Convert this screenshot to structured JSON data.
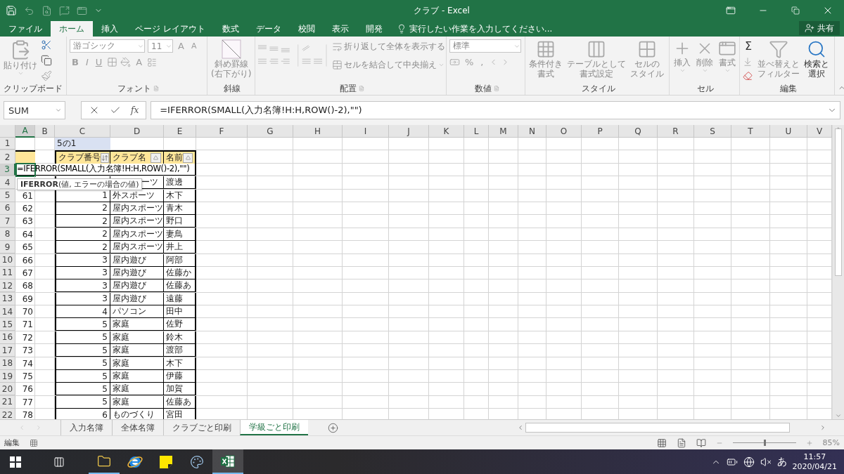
{
  "title_bar": {
    "title": "クラブ - Excel"
  },
  "ribbon_tabs": [
    {
      "label": "ファイル",
      "selected": false
    },
    {
      "label": "ホーム",
      "selected": true
    },
    {
      "label": "挿入",
      "selected": false
    },
    {
      "label": "ページ レイアウト",
      "selected": false
    },
    {
      "label": "数式",
      "selected": false
    },
    {
      "label": "データ",
      "selected": false
    },
    {
      "label": "校閲",
      "selected": false
    },
    {
      "label": "表示",
      "selected": false
    },
    {
      "label": "開発",
      "selected": false
    }
  ],
  "tell_me": "実行したい作業を入力してください...",
  "share": "共有",
  "ribbon": {
    "clipboard": {
      "label": "クリップボード",
      "paste": "貼り付け"
    },
    "font": {
      "label": "フォント",
      "font_name": "游ゴシック",
      "font_size": "11",
      "grow": "A",
      "shrink": "A",
      "styles": [
        "B",
        "I",
        "U"
      ],
      "font_color": "A"
    },
    "diagonal": {
      "label": "斜線",
      "button": [
        "斜め罫線",
        "(右下がり)"
      ]
    },
    "alignment": {
      "label": "配置",
      "wrap": "折り返して全体を表示する",
      "merge": "セルを結合して中央揃え"
    },
    "number": {
      "label": "数値",
      "format": "標準",
      "percent": "%",
      "comma": ","
    },
    "styles": {
      "label": "スタイル",
      "buttons": [
        [
          "条件付き",
          "書式"
        ],
        [
          "テーブルとして",
          "書式設定"
        ],
        [
          "セルの",
          "スタイル"
        ]
      ]
    },
    "cells": {
      "label": "セル",
      "buttons": [
        "挿入",
        "削除",
        "書式"
      ]
    },
    "editing": {
      "label": "編集",
      "autosum": "Σ",
      "buttons": [
        [
          "並べ替えと",
          "フィルター"
        ],
        [
          "検索と",
          "選択"
        ]
      ]
    }
  },
  "formula_bar": {
    "name_box": "SUM",
    "fx": "fx",
    "formula": "=IFERROR(SMALL(入力名簿!H:H,ROW()-2),\"\")"
  },
  "columns": [
    {
      "label": "A",
      "selected": true
    },
    {
      "label": "B",
      "selected": false
    },
    {
      "label": "C",
      "selected": false
    },
    {
      "label": "D",
      "selected": false
    },
    {
      "label": "E",
      "selected": false
    },
    {
      "label": "F",
      "selected": false
    },
    {
      "label": "G",
      "selected": false
    },
    {
      "label": "H",
      "selected": false
    },
    {
      "label": "I",
      "selected": false
    },
    {
      "label": "J",
      "selected": false
    },
    {
      "label": "K",
      "selected": false
    },
    {
      "label": "L",
      "selected": false
    },
    {
      "label": "M",
      "selected": false
    },
    {
      "label": "N",
      "selected": false
    },
    {
      "label": "O",
      "selected": false
    },
    {
      "label": "P",
      "selected": false
    },
    {
      "label": "Q",
      "selected": false
    },
    {
      "label": "R",
      "selected": false
    },
    {
      "label": "S",
      "selected": false
    },
    {
      "label": "T",
      "selected": false
    },
    {
      "label": "U",
      "selected": false
    },
    {
      "label": "V",
      "selected": false
    }
  ],
  "rows": [
    {
      "number": "1",
      "selected": false,
      "kind": "title",
      "c": "5の1"
    },
    {
      "number": "2",
      "selected": false,
      "kind": "header",
      "c": {
        "text": "クラブ番号",
        "sorted": true
      },
      "d": {
        "text": "クラブ名",
        "sorted": false
      },
      "e": {
        "text": "名前",
        "sorted": false
      }
    },
    {
      "number": "3",
      "selected": true,
      "kind": "editing",
      "formula": "=IFERROR(SMALL(入力名簿!H:H,ROW()-2),\"\")"
    },
    {
      "number": "4",
      "selected": false,
      "kind": "data",
      "d": "ーツ",
      "e": "渡邊"
    },
    {
      "number": "5",
      "selected": false,
      "kind": "data",
      "a": "61",
      "c": "1",
      "d": "外スポーツ",
      "e": "木下"
    },
    {
      "number": "6",
      "selected": false,
      "kind": "data",
      "a": "62",
      "c": "2",
      "d": "屋内スポーツ",
      "e": "青木"
    },
    {
      "number": "7",
      "selected": false,
      "kind": "data",
      "a": "63",
      "c": "2",
      "d": "屋内スポーツ",
      "e": "野口"
    },
    {
      "number": "8",
      "selected": false,
      "kind": "data",
      "a": "64",
      "c": "2",
      "d": "屋内スポーツ",
      "e": "妻鳥"
    },
    {
      "number": "9",
      "selected": false,
      "kind": "data",
      "a": "65",
      "c": "2",
      "d": "屋内スポーツ",
      "e": "井上"
    },
    {
      "number": "10",
      "selected": false,
      "kind": "data",
      "a": "66",
      "c": "3",
      "d": "屋内遊び",
      "e": "阿部"
    },
    {
      "number": "11",
      "selected": false,
      "kind": "data",
      "a": "67",
      "c": "3",
      "d": "屋内遊び",
      "e": "佐藤か"
    },
    {
      "number": "12",
      "selected": false,
      "kind": "data",
      "a": "68",
      "c": "3",
      "d": "屋内遊び",
      "e": "佐藤あ"
    },
    {
      "number": "13",
      "selected": false,
      "kind": "data",
      "a": "69",
      "c": "3",
      "d": "屋内遊び",
      "e": "遠藤"
    },
    {
      "number": "14",
      "selected": false,
      "kind": "data",
      "a": "70",
      "c": "4",
      "d": "パソコン",
      "e": "田中"
    },
    {
      "number": "15",
      "selected": false,
      "kind": "data",
      "a": "71",
      "c": "5",
      "d": "家庭",
      "e": "佐野"
    },
    {
      "number": "16",
      "selected": false,
      "kind": "data",
      "a": "72",
      "c": "5",
      "d": "家庭",
      "e": "鈴木"
    },
    {
      "number": "17",
      "selected": false,
      "kind": "data",
      "a": "73",
      "c": "5",
      "d": "家庭",
      "e": "渡部"
    },
    {
      "number": "18",
      "selected": false,
      "kind": "data",
      "a": "74",
      "c": "5",
      "d": "家庭",
      "e": "木下"
    },
    {
      "number": "19",
      "selected": false,
      "kind": "data",
      "a": "75",
      "c": "5",
      "d": "家庭",
      "e": "伊藤"
    },
    {
      "number": "20",
      "selected": false,
      "kind": "data",
      "a": "76",
      "c": "5",
      "d": "家庭",
      "e": "加賀"
    },
    {
      "number": "21",
      "selected": false,
      "kind": "data",
      "a": "77",
      "c": "5",
      "d": "家庭",
      "e": "佐藤あ"
    },
    {
      "number": "22",
      "selected": false,
      "kind": "data",
      "a": "78",
      "c": "6",
      "d": "ものづくり",
      "e": "宮田"
    }
  ],
  "tooltip": "**IFERROR**(値, エラーの場合の値)",
  "sheet_tabs": [
    {
      "label": "入力名簿",
      "selected": false
    },
    {
      "label": "全体名簿",
      "selected": false
    },
    {
      "label": "クラブごと印刷",
      "selected": false
    },
    {
      "label": "学級ごと印刷",
      "selected": true
    }
  ],
  "status_bar": {
    "mode": "編集",
    "zoom_slider": {
      "level": 0.5
    },
    "zoom": "85%"
  },
  "taskbar": {
    "ime": "あ",
    "time": "11:57",
    "date": "2020/04/21"
  }
}
